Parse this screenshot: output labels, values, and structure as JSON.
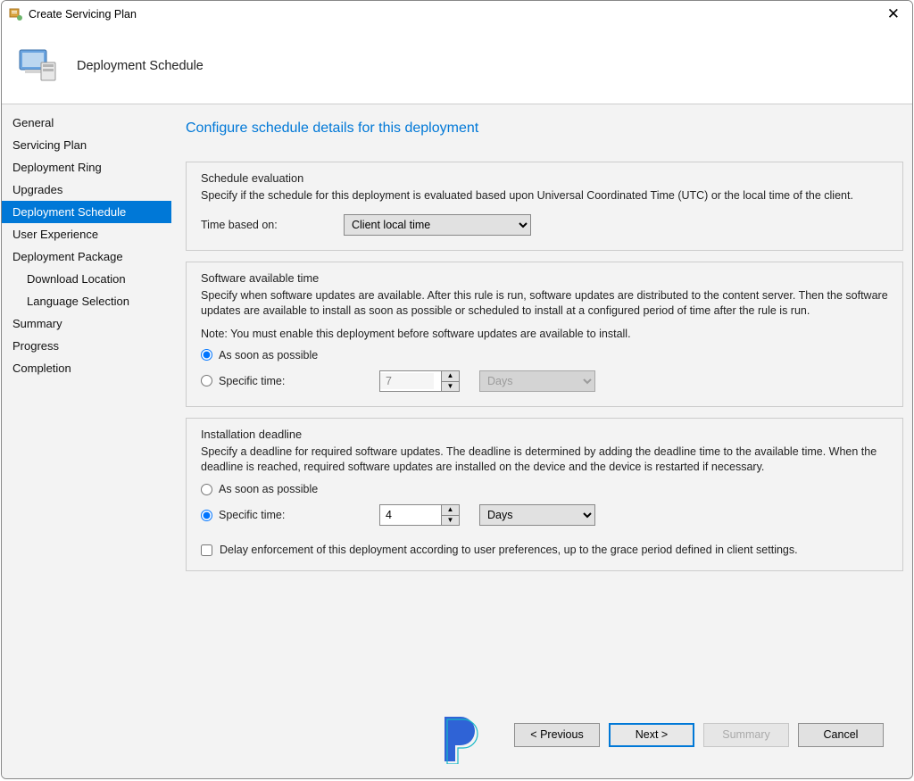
{
  "window": {
    "title": "Create Servicing Plan"
  },
  "header": {
    "title": "Deployment Schedule"
  },
  "sidebar": [
    "General",
    "Servicing Plan",
    "Deployment Ring",
    "Upgrades",
    "Deployment Schedule",
    "User Experience",
    "Deployment Package",
    "Download Location",
    "Language Selection",
    "Summary",
    "Progress",
    "Completion"
  ],
  "content": {
    "heading": "Configure schedule details for this deployment",
    "schedule_eval": {
      "title": "Schedule evaluation",
      "desc": "Specify if the schedule for this deployment is evaluated based upon Universal Coordinated Time (UTC) or the local time of the client.",
      "time_based_on_label": "Time based on:",
      "time_based_on_value": "Client local time"
    },
    "available": {
      "title": "Software available time",
      "desc": "Specify when software updates are available. After this rule is run, software updates are distributed to the content server. Then the software updates are available to install as soon as possible or scheduled to install at a configured period of time after the rule is run.",
      "note": "Note: You must enable this deployment before software updates are available to install.",
      "radio_asap": "As soon as possible",
      "radio_specific": "Specific time:",
      "value": "7",
      "unit": "Days"
    },
    "deadline": {
      "title": "Installation deadline",
      "desc": "Specify a deadline for required software updates. The deadline is determined by adding the deadline time to the available time. When the deadline is reached, required software updates are installed on the device and the device is restarted if necessary.",
      "radio_asap": "As soon as possible",
      "radio_specific": "Specific time:",
      "value": "4",
      "unit": "Days",
      "delay_label": "Delay enforcement of this deployment according to user preferences, up to the grace period defined in client settings."
    }
  },
  "footer": {
    "previous": "< Previous",
    "next": "Next >",
    "summary": "Summary",
    "cancel": "Cancel"
  }
}
